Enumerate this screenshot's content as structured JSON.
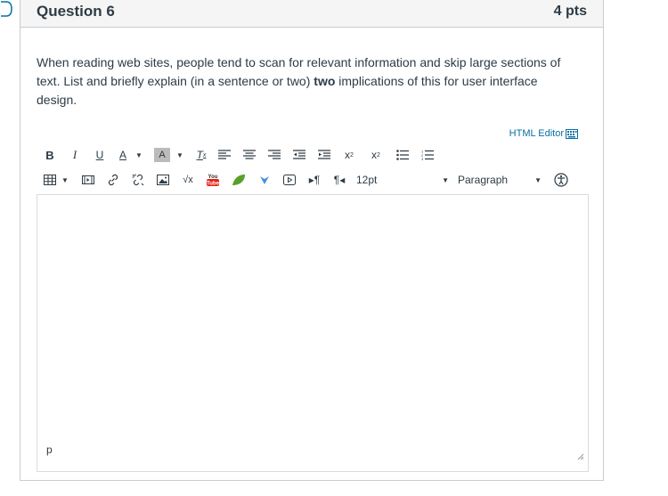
{
  "question": {
    "title": "Question 6",
    "points": "4 pts",
    "text_before": "When reading web sites, people tend to scan for relevant information and skip large sections of text.  List and briefly explain (in a sentence or two) ",
    "text_bold": "two",
    "text_after": " implications of this for user interface design."
  },
  "editor": {
    "html_editor_label": "HTML Editor",
    "font_size": "12pt",
    "block_format": "Paragraph",
    "path": "p"
  },
  "colors": {
    "link": "#0770a3",
    "text": "#2d3b45",
    "border": "#c7cdd1"
  }
}
